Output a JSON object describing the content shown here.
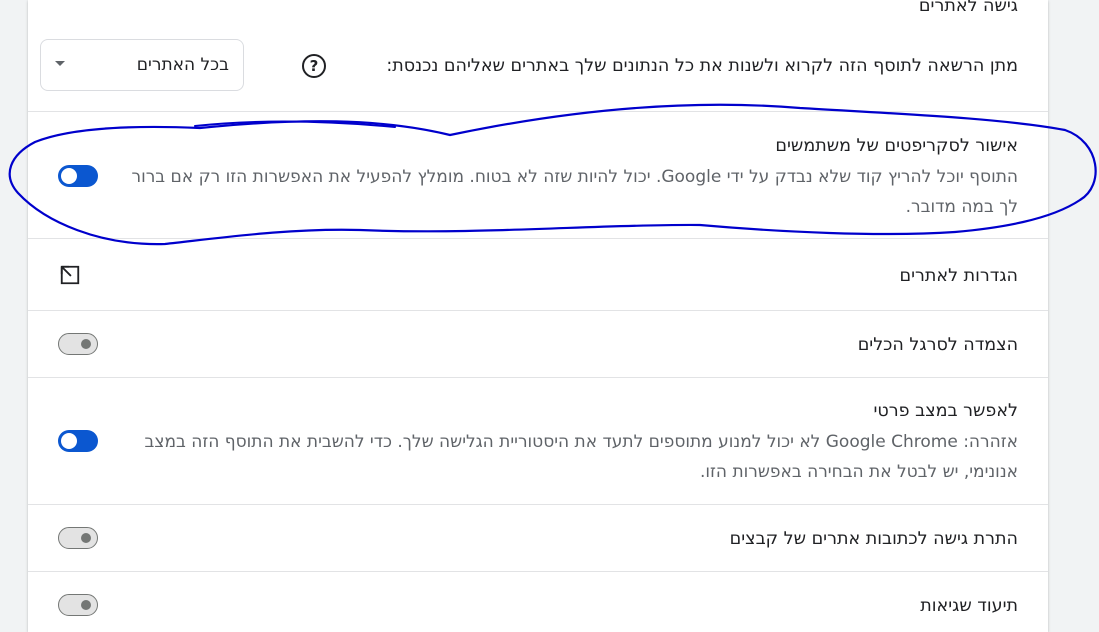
{
  "site_access": {
    "title": "גישה לאתרים",
    "description": "מתן הרשאה לתוסף הזה לקרוא ולשנות את כל הנתונים שלך באתרים שאליהם נכנסת:",
    "help_icon_glyph": "?",
    "select": {
      "value": "בכל האתרים"
    }
  },
  "settings": [
    {
      "title": "אישור לסקריפטים של משתמשים",
      "description": "התוסף יוכל להריץ קוד שלא נבדק על ידי Google. יכול להיות שזה לא בטוח. מומלץ להפעיל את האפשרות הזו רק אם ברור לך במה מדובר.",
      "enabled": true
    },
    {
      "title": "הגדרות לאתרים",
      "icon": "launch-icon"
    },
    {
      "title": "הצמדה לסרגל הכלים",
      "enabled": false
    },
    {
      "title": "לאפשר במצב פרטי",
      "description": "אזהרה: Google Chrome לא יכול למנוע מתוספים לתעד את היסטוריית הגלישה שלך. כדי להשבית את התוסף הזה במצב אנונימי, יש לבטל את הבחירה באפשרות הזו.",
      "enabled": true
    },
    {
      "title": "התרת גישה לכתובות אתרים של קבצים",
      "enabled": false
    },
    {
      "title": "תיעוד שגיאות",
      "enabled": false
    }
  ],
  "colors": {
    "toggle_on": "#0b57d0",
    "annotation": "#0000cc"
  }
}
